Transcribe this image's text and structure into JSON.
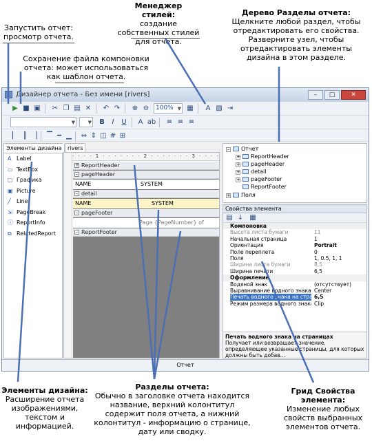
{
  "callouts": {
    "style_manager": {
      "title": "Менеджер стилей:",
      "text": "создание собственных стилей для отчета."
    },
    "run_report": {
      "text": "Запустить отчет: просмотр отчета."
    },
    "sections_tree": {
      "title": "Дерево Разделы отчета:",
      "text": "Щелкните любой раздел, чтобы отредактировать его свойства. Разверните узел, чтобы отредактировать элементы дизайна в этом разделе."
    },
    "save_layout": {
      "text": "Сохранение файла компоновки отчета: может использоваться как шаблон отчета."
    },
    "design_elements": {
      "title": "Элементы дизайна:",
      "text": "Расширение отчета изображениями, текстом и информацией."
    },
    "report_sections": {
      "title": "Разделы отчета:",
      "text": "Обычно в заголовке отчета находится название, верхний колонтитул содержит поля отчета, а нижний колонтитул - информацию о странице, дату или сводку."
    },
    "properties_grid": {
      "title": "Грид Свойства элемента:",
      "text": "Изменение любых свойств выбранных элементов отчета."
    }
  },
  "window": {
    "title": "Дизайнер отчета - Без имени [rivers]"
  },
  "toolbar": {
    "zoom": "100%"
  },
  "icons": [
    "run-icon",
    "save-icon",
    "save-as-icon",
    "cut-icon",
    "copy-icon",
    "paste-icon",
    "delete-icon",
    "undo-icon",
    "redo-icon",
    "zoom-in-icon",
    "zoom-out-icon",
    "style-manager-icon",
    "bold-icon",
    "italic-icon",
    "underline-icon",
    "align-left-icon",
    "align-center-icon",
    "align-right-icon"
  ],
  "toolbox": {
    "tabs": [
      "Элементы дизайна",
      "rivers"
    ],
    "items": [
      {
        "label": "Label",
        "icon": "label-icon"
      },
      {
        "label": "TextBox",
        "icon": "textbox-icon"
      },
      {
        "label": "Графика",
        "icon": "graphics-icon"
      },
      {
        "label": "Picture",
        "icon": "picture-icon"
      },
      {
        "label": "Line",
        "icon": "line-icon"
      },
      {
        "label": "PageBreak",
        "icon": "pagebreak-icon"
      },
      {
        "label": "ReportInfo",
        "icon": "reportinfo-icon"
      },
      {
        "label": "RelatedReport",
        "icon": "relatedreport-icon"
      }
    ]
  },
  "designer": {
    "bands": {
      "report_header": "ReportHeader",
      "page_header": "pageHeader",
      "detail": "detail",
      "page_footer": "pageFooter",
      "report_footer": "ReportFooter"
    },
    "page_header_fields": [
      "NAME",
      "SYSTEM"
    ],
    "detail_fields": [
      "NAME",
      "SYSTEM"
    ],
    "page_footer_text": "Page {PageNumber} of {PageCount}"
  },
  "tree": {
    "root": "Отчет",
    "children": [
      "ReportHeader",
      "pageHeader",
      "detail",
      "pageFooter",
      "ReportFooter"
    ],
    "fields": "Поля"
  },
  "props": {
    "header": "Свойства элемента",
    "rows": [
      {
        "name": "Компоновка",
        "value": "",
        "kind": "cat"
      },
      {
        "name": "Высота листа бумаги",
        "value": "11",
        "kind": "dim"
      },
      {
        "name": "Начальная страница",
        "value": "1",
        "kind": ""
      },
      {
        "name": "Ориентация",
        "value": "Portrait",
        "kind": "bold"
      },
      {
        "name": "Поле переплета",
        "value": "0",
        "kind": ""
      },
      {
        "name": "Поля",
        "value": "1, 0.5, 1, 1",
        "kind": ""
      },
      {
        "name": "Ширина листа бумаги",
        "value": "8,5",
        "kind": "dim"
      },
      {
        "name": "Ширина печати",
        "value": "6,5",
        "kind": ""
      },
      {
        "name": "Оформление",
        "value": "",
        "kind": "cat"
      },
      {
        "name": "Водяной знак",
        "value": "(отсутствует)",
        "kind": ""
      },
      {
        "name": "Выравнивание водного знака",
        "value": "Center",
        "kind": ""
      },
      {
        "name": "Печать водного знака на страницах",
        "value": "6,5",
        "kind": "sel"
      },
      {
        "name": "Режим размера водного знака",
        "value": "Clip",
        "kind": ""
      }
    ],
    "desc_title": "Печать водного знака на страницах",
    "desc_text": "Получает или возвращает значение, определяющее указанные страницы, для которых должны быть добав..."
  },
  "status": "Отчет"
}
